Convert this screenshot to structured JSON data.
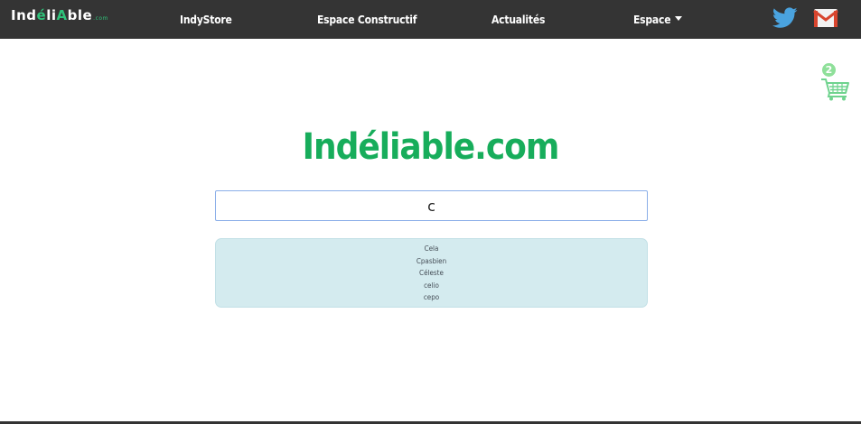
{
  "navbar": {
    "brand": {
      "main": "Ind",
      "accent": "é",
      "rest": "li",
      "accent2": "A",
      "end": "ble",
      "domain": ".com"
    },
    "links": [
      {
        "label": "IndyStore"
      },
      {
        "label": "Espace Constructif"
      },
      {
        "label": "Actualités"
      },
      {
        "label": "Espace"
      }
    ]
  },
  "cart": {
    "count": "2"
  },
  "main": {
    "title": "Indéliable.com",
    "search": {
      "value": "c"
    },
    "suggestions": [
      "Cela",
      "Cpasbien",
      "Céleste",
      "celio",
      "cepo"
    ]
  },
  "colors": {
    "navbar_bg": "#343434",
    "brand_green": "#17ad5b",
    "twitter_blue": "#4aa3df",
    "suggestion_bg": "#d4ebef"
  },
  "icons": [
    "twitter-icon",
    "gmail-icon",
    "shopping-cart-icon",
    "caret-down-icon"
  ]
}
